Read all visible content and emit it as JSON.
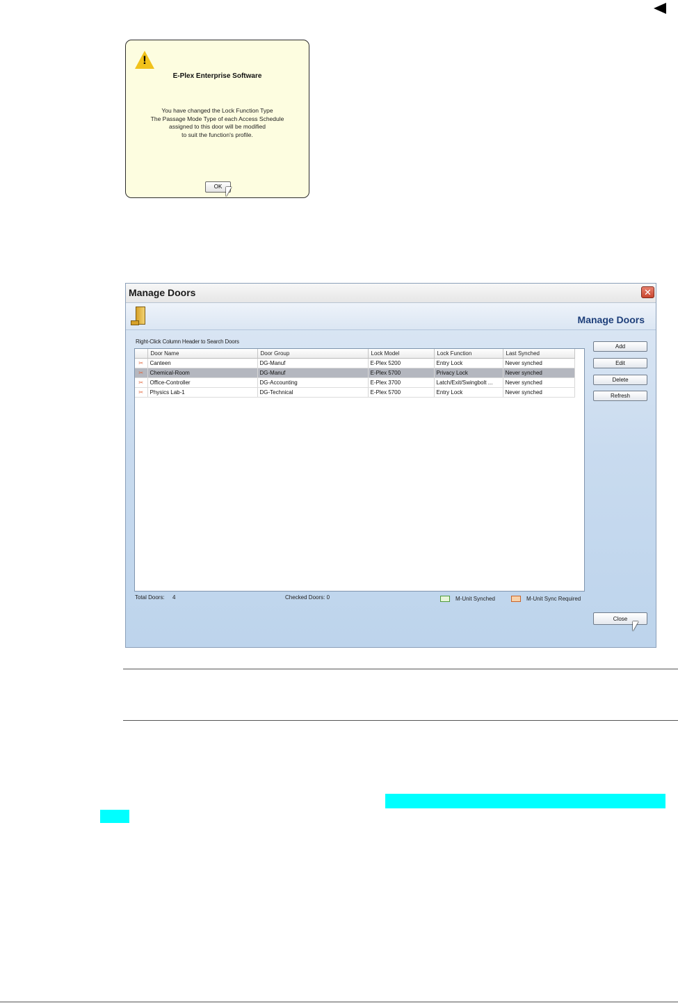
{
  "alert": {
    "title": "E-Plex Enterprise Software",
    "message_lines": [
      "You have changed the Lock Function Type",
      "The Passage Mode Type of each Access Schedule",
      "assigned to this door will be modified",
      "to suit the function's profile."
    ],
    "ok_label": "OK",
    "icon": "warning-icon"
  },
  "window": {
    "title": "Manage Doors",
    "banner_title": "Manage Doors",
    "close_glyph": "✕",
    "hint": "Right-Click Column Header to Search Doors",
    "columns": [
      "Door Name",
      "Door Group",
      "Lock Model",
      "Lock Function",
      "Last Synched"
    ],
    "rows": [
      {
        "door_name": "Canteen",
        "door_group": "DG-Manuf",
        "lock_model": "E-Plex 5200",
        "lock_function": "Entry Lock",
        "last_synched": "Never synched",
        "selected": false
      },
      {
        "door_name": "Chemical-Room",
        "door_group": "DG-Manuf",
        "lock_model": "E-Plex 5700",
        "lock_function": "Privacy Lock",
        "last_synched": "Never synched",
        "selected": true
      },
      {
        "door_name": "Office-Controller",
        "door_group": "DG-Accounting",
        "lock_model": "E-Plex 3700",
        "lock_function": "Latch/Exit/Swingbolt ...",
        "last_synched": "Never synched",
        "selected": false
      },
      {
        "door_name": "Physics Lab-1",
        "door_group": "DG-Technical",
        "lock_model": "E-Plex 5700",
        "lock_function": "Entry Lock",
        "last_synched": "Never synched",
        "selected": false
      }
    ],
    "sync_glyph": "✂",
    "buttons": {
      "add": "Add",
      "edit": "Edit",
      "delete": "Delete",
      "refresh": "Refresh",
      "close": "Close"
    },
    "footer": {
      "total_label": "Total Doors:",
      "total_value": "4",
      "checked_label": "Checked Doors: 0",
      "legend_synched": "M-Unit Synched",
      "legend_required": "M-Unit Sync Required"
    },
    "colors": {
      "synched": "#4f9a3b",
      "sync_required": "#c8642a",
      "title_blue": "#1e3f7a"
    }
  },
  "page": {
    "highlight_color": "#00ffff",
    "nav_icon": "back-arrow-icon"
  }
}
